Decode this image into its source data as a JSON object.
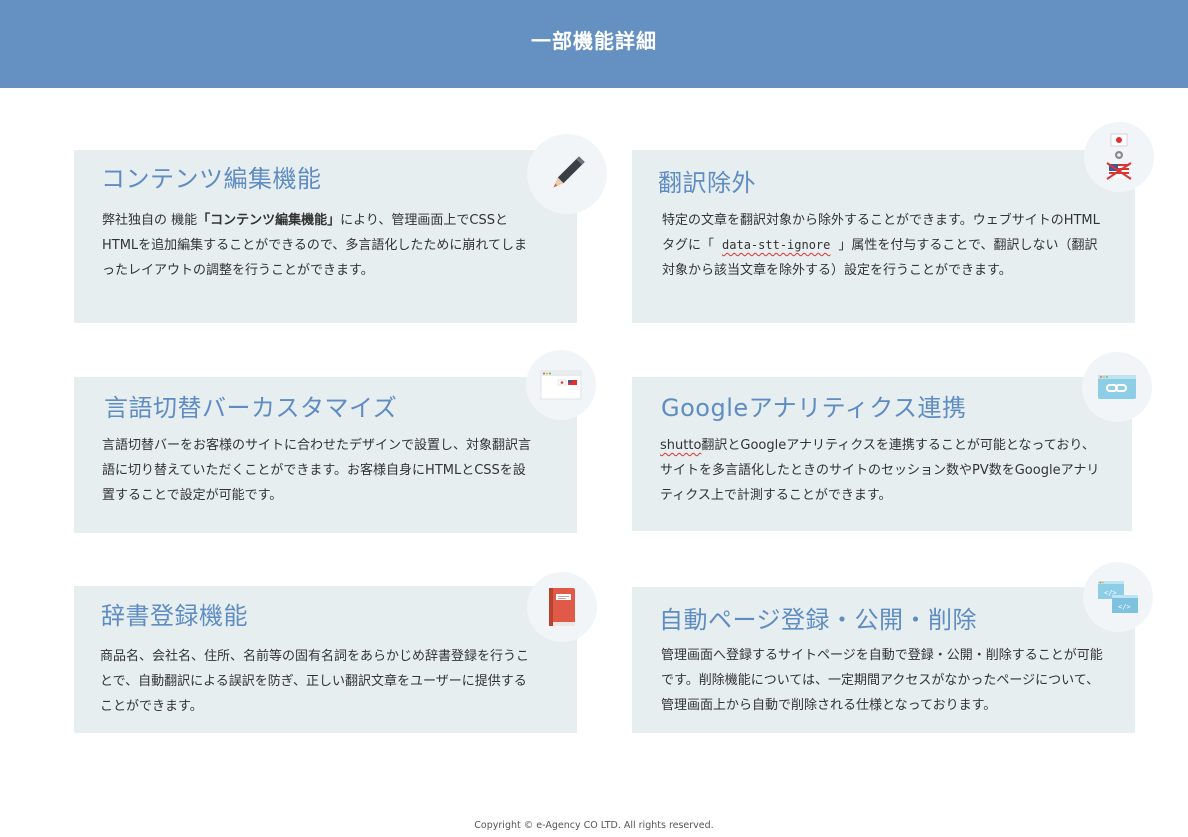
{
  "header": {
    "title": "一部機能詳細"
  },
  "cards": [
    {
      "title": "コンテンツ編集機能",
      "body_pre": "弊社独自の 機能",
      "body_bold": "「コンテンツ編集機能」",
      "body_post": "により、管理画面上でCSSとHTMLを追加編集することができるので、多言語化したために崩れてしまったレイアウトの調整を行うことができます。",
      "icon": "pencil-icon"
    },
    {
      "title": "翻訳除外",
      "body_pre": "特定の文章を翻訳対象から除外することができます。ウェブサイトのHTMLタグに「",
      "body_code": "data-stt-ignore",
      "body_post": "」属性を付与することで、翻訳しない（翻訳対象から該当文章を除外する）設定を行うことができます。",
      "icon": "flag-exclude-icon"
    },
    {
      "title": "言語切替バーカスタマイズ",
      "body": "言語切替バーをお客様のサイトに合わせたデザインで設置し、対象翻訳言語に切り替えていただくことができます。お客様自身にHTMLとCSSを設置することで設定が可能です。",
      "icon": "language-bar-icon"
    },
    {
      "title": "Googleアナリティクス連携",
      "body_squiggle": "shutto",
      "body_post": "翻訳とGoogleアナリティクスを連携することが可能となっており、サイトを多言語化したときのサイトのセッション数やPV数をGoogleアナリティクス上で計測することができます。",
      "icon": "link-icon"
    },
    {
      "title": "辞書登録機能",
      "body": "商品名、会社名、住所、名前等の固有名詞をあらかじめ辞書登録を行うことで、自動翻訳による誤訳を防ぎ、正しい翻訳文章をユーザーに提供することができます。",
      "icon": "book-icon"
    },
    {
      "title": "自動ページ登録・公開・削除",
      "body": "管理画面へ登録するサイトページを自動で登録・公開・削除することが可能です。削除機能については、一定期間アクセスがなかったページについて、管理画面上から自動で削除される仕様となっております。",
      "icon": "code-window-icon"
    }
  ],
  "footer": {
    "copyright": "Copyright © e-Agency CO LTD. All rights reserved."
  }
}
